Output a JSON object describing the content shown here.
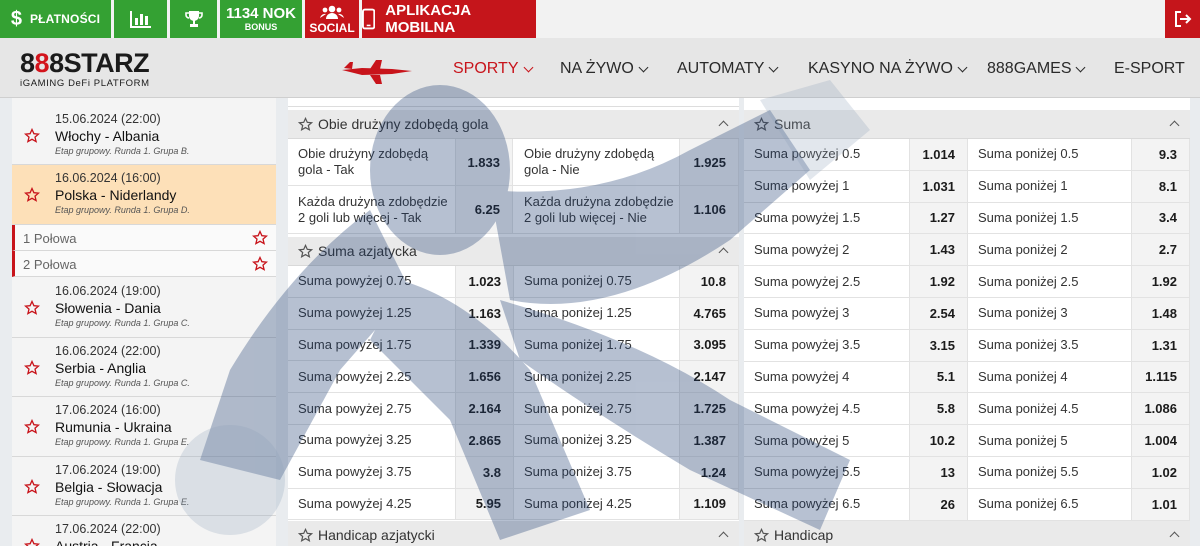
{
  "topbar": {
    "payments_label": "PŁATNOŚCI",
    "bonus_amount": "1134 NOK",
    "bonus_label": "BONUS",
    "social_label": "SOCIAL",
    "mobile_app_label": "APLIKACJA MOBILNA",
    "icons": [
      "dollar-icon",
      "bar-chart-icon",
      "trophy-icon",
      "people-icon",
      "smartphone-icon",
      "logout-icon"
    ]
  },
  "logo": {
    "brand": "888STARZ",
    "brand_a": "8",
    "brand_b": "8",
    "brand_c": "8",
    "brand_d": "STARZ",
    "tagline": "iGAMING DeFi PLATFORM"
  },
  "nav": {
    "items": [
      {
        "label": "SPORTY",
        "active": true
      },
      {
        "label": "NA ŻYWO"
      },
      {
        "label": "AUTOMATY"
      },
      {
        "label": "KASYNO NA ŻYWO"
      },
      {
        "label": "888GAMES"
      },
      {
        "label": "E-SPORT"
      }
    ]
  },
  "sidebar": {
    "events": [
      {
        "date": "15.06.2024 (22:00)",
        "teams": "Włochy - Albania",
        "stage": "Etap grupowy. Runda 1. Grupa B."
      },
      {
        "date": "16.06.2024 (16:00)",
        "teams": "Polska - Niderlandy",
        "stage": "Etap grupowy. Runda 1. Grupa D.",
        "selected": true
      },
      {
        "date": "16.06.2024 (19:00)",
        "teams": "Słowenia - Dania",
        "stage": "Etap grupowy. Runda 1. Grupa C."
      },
      {
        "date": "16.06.2024 (22:00)",
        "teams": "Serbia - Anglia",
        "stage": "Etap grupowy. Runda 1. Grupa C."
      },
      {
        "date": "17.06.2024 (16:00)",
        "teams": "Rumunia - Ukraina",
        "stage": "Etap grupowy. Runda 1. Grupa E."
      },
      {
        "date": "17.06.2024 (19:00)",
        "teams": "Belgia - Słowacja",
        "stage": "Etap grupowy. Runda 1. Grupa E."
      },
      {
        "date": "17.06.2024 (22:00)",
        "teams": "Austria - Francja",
        "stage": ""
      }
    ],
    "halves": [
      "1 Połowa",
      "2 Połowa"
    ]
  },
  "markets_left": {
    "btts": {
      "title": "Obie drużyny zdobędą gola",
      "rows": [
        [
          {
            "name": "Obie drużyny zdobędą gola - Tak",
            "odd": "1.833"
          },
          {
            "name": "Obie drużyny zdobędą gola - Nie",
            "odd": "1.925"
          }
        ],
        [
          {
            "name": "Każda drużyna zdobędzie 2 goli lub więcej - Tak",
            "odd": "6.25"
          },
          {
            "name": "Każda drużyna zdobędzie 2 goli lub więcej - Nie",
            "odd": "1.106"
          }
        ]
      ]
    },
    "asian_total": {
      "title": "Suma azjatycka",
      "rows": [
        [
          {
            "name": "Suma powyżej 0.75",
            "odd": "1.023"
          },
          {
            "name": "Suma poniżej 0.75",
            "odd": "10.8"
          }
        ],
        [
          {
            "name": "Suma powyżej 1.25",
            "odd": "1.163"
          },
          {
            "name": "Suma poniżej 1.25",
            "odd": "4.765"
          }
        ],
        [
          {
            "name": "Suma powyżej 1.75",
            "odd": "1.339"
          },
          {
            "name": "Suma poniżej 1.75",
            "odd": "3.095"
          }
        ],
        [
          {
            "name": "Suma powyżej 2.25",
            "odd": "1.656"
          },
          {
            "name": "Suma poniżej 2.25",
            "odd": "2.147"
          }
        ],
        [
          {
            "name": "Suma powyżej 2.75",
            "odd": "2.164"
          },
          {
            "name": "Suma poniżej 2.75",
            "odd": "1.725"
          }
        ],
        [
          {
            "name": "Suma powyżej 3.25",
            "odd": "2.865"
          },
          {
            "name": "Suma poniżej 3.25",
            "odd": "1.387"
          }
        ],
        [
          {
            "name": "Suma powyżej 3.75",
            "odd": "3.8"
          },
          {
            "name": "Suma poniżej 3.75",
            "odd": "1.24"
          }
        ],
        [
          {
            "name": "Suma powyżej 4.25",
            "odd": "5.95"
          },
          {
            "name": "Suma poniżej 4.25",
            "odd": "1.109"
          }
        ]
      ]
    },
    "asian_handicap": {
      "title": "Handicap azjatycki"
    }
  },
  "markets_right": {
    "total": {
      "title": "Suma",
      "rows": [
        [
          {
            "name": "Suma powyżej 0.5",
            "odd": "1.014"
          },
          {
            "name": "Suma poniżej 0.5",
            "odd": "9.3"
          }
        ],
        [
          {
            "name": "Suma powyżej 1",
            "odd": "1.031"
          },
          {
            "name": "Suma poniżej 1",
            "odd": "8.1"
          }
        ],
        [
          {
            "name": "Suma powyżej 1.5",
            "odd": "1.27"
          },
          {
            "name": "Suma poniżej 1.5",
            "odd": "3.4"
          }
        ],
        [
          {
            "name": "Suma powyżej 2",
            "odd": "1.43"
          },
          {
            "name": "Suma poniżej 2",
            "odd": "2.7"
          }
        ],
        [
          {
            "name": "Suma powyżej 2.5",
            "odd": "1.92"
          },
          {
            "name": "Suma poniżej 2.5",
            "odd": "1.92"
          }
        ],
        [
          {
            "name": "Suma powyżej 3",
            "odd": "2.54"
          },
          {
            "name": "Suma poniżej 3",
            "odd": "1.48"
          }
        ],
        [
          {
            "name": "Suma powyżej 3.5",
            "odd": "3.15"
          },
          {
            "name": "Suma poniżej 3.5",
            "odd": "1.31"
          }
        ],
        [
          {
            "name": "Suma powyżej 4",
            "odd": "5.1"
          },
          {
            "name": "Suma poniżej 4",
            "odd": "1.115"
          }
        ],
        [
          {
            "name": "Suma powyżej 4.5",
            "odd": "5.8"
          },
          {
            "name": "Suma poniżej 4.5",
            "odd": "1.086"
          }
        ],
        [
          {
            "name": "Suma powyżej 5",
            "odd": "10.2"
          },
          {
            "name": "Suma poniżej 5",
            "odd": "1.004"
          }
        ],
        [
          {
            "name": "Suma powyżej 5.5",
            "odd": "13"
          },
          {
            "name": "Suma poniżej 5.5",
            "odd": "1.02"
          }
        ],
        [
          {
            "name": "Suma powyżej 6.5",
            "odd": "26"
          },
          {
            "name": "Suma poniżej 6.5",
            "odd": "1.01"
          }
        ]
      ]
    },
    "handicap": {
      "title": "Handicap"
    }
  },
  "colors": {
    "green": "#34a133",
    "red": "#c5151b",
    "accent": "#c8141b",
    "selected_event": "#fde0b8"
  }
}
